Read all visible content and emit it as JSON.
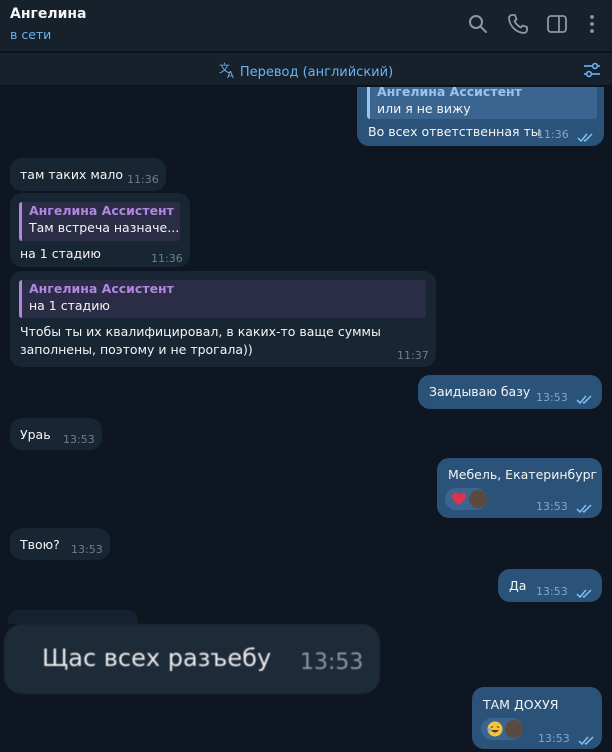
{
  "header": {
    "name": "Ангелина",
    "status": "в сети"
  },
  "translate": {
    "label": "Перевод (английский)"
  },
  "colors": {
    "background": "#0e1621",
    "incoming": "#182533",
    "outgoing": "#2b5278",
    "accent": "#6ab3f3",
    "reply_author": "#b086e0"
  },
  "messages": [
    {
      "dir": "out",
      "reply_author": "Ангелина Ассистент",
      "reply_text": "или я не вижу",
      "text": "Во всех ответственная ты",
      "time": "11:36",
      "read": true
    },
    {
      "dir": "in",
      "text": "там таких мало",
      "time": "11:36"
    },
    {
      "dir": "in",
      "reply_author": "Ангелина Ассистент",
      "reply_text": "Там встреча назначе...",
      "text": "на 1 стадию",
      "time": "11:36"
    },
    {
      "dir": "in",
      "reply_author": "Ангелина Ассистент",
      "reply_text": "на 1 стадию",
      "text_line1": "Чтобы ты их квалифицировал, в каких-то ваще суммы",
      "text_line2": "заполнены,  поэтому и не трогала))",
      "time": "11:37"
    },
    {
      "dir": "out",
      "text": "Заидываю базу",
      "time": "13:53",
      "read": true
    },
    {
      "dir": "in",
      "text": "Ураь",
      "time": "13:53"
    },
    {
      "dir": "out",
      "text": "Мебель, Екатеринбург",
      "time": "13:53",
      "read": true,
      "reaction": "heart"
    },
    {
      "dir": "in",
      "text": "Твою?",
      "time": "13:53"
    },
    {
      "dir": "out",
      "text": "Да",
      "time": "13:53",
      "read": true
    },
    {
      "dir": "in",
      "text": "Щас всех разъебу",
      "time": "13:53",
      "enlarged": true
    },
    {
      "dir": "out",
      "text": "ТАМ ДОХУЯ",
      "time": "13:53",
      "read": true,
      "reaction": "laughing-face"
    }
  ]
}
